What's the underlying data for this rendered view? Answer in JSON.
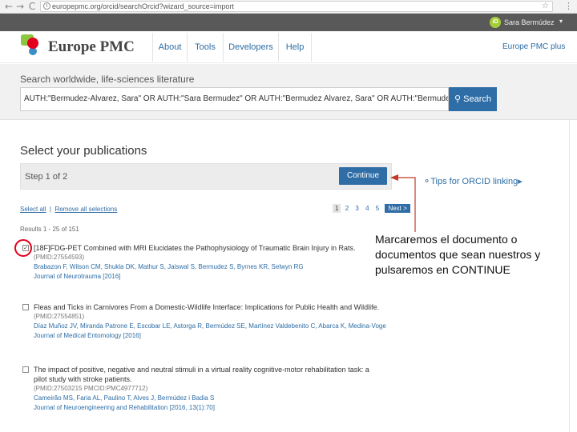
{
  "browser": {
    "back": "←",
    "forward": "→",
    "reload": "C",
    "url": "europepmc.org/orcid/searchOrcid?wizard_source=import",
    "star": "☆",
    "menu": "⋮"
  },
  "user": {
    "orcid_badge": "iD",
    "name": "Sara Bermúdez",
    "caret": "▾"
  },
  "header": {
    "logo_text": "Europe PMC",
    "nav": [
      "About",
      "Tools",
      "Developers",
      "Help"
    ],
    "pmc_plus": "Europe PMC plus"
  },
  "search": {
    "label": "Search worldwide, life-sciences literature",
    "query": "AUTH:\"Bermudez-Alvarez, Sara\" OR AUTH:\"Sara Bermudez\" OR AUTH:\"Bermudez Alvarez, Sara\" OR AUTH:\"Bermudez-Alvarez, S\" OR",
    "button": "Search"
  },
  "publications": {
    "title": "Select your publications",
    "step": "Step 1 of 2",
    "continue": "Continue",
    "tips": "Tips for ORCID linking",
    "select_all": "Select all",
    "remove_all": "Remove all selections",
    "pages": [
      "1",
      "2",
      "3",
      "4",
      "5"
    ],
    "next": "Next",
    "results_count": "Results 1 - 25 of 151"
  },
  "results": [
    {
      "checked": true,
      "title": "[18F]FDG-PET Combined with MRI Elucidates the Pathophysiology of Traumatic Brain Injury in Rats.",
      "meta": "(PMID:27554593)",
      "authors": "Brabazon F, Wilson CM, Shukla DK, Mathur S, Jaiswal S, Bermudez S, Byrnes KR, Selwyn RG",
      "journal": "Journal of Neurotrauma [2016]"
    },
    {
      "checked": false,
      "title": "Fleas and Ticks in Carnivores From a Domestic-Wildlife Interface: Implications for Public Health and Wildlife.",
      "meta": "(PMID:27554851)",
      "authors": "Díaz Muñoz JV, Miranda Patrone E, Escobar LE, Astorga R, Bermúdez SE, Martínez Valdebenito C, Abarca K, Medina-Vogel G",
      "journal": "Journal of Medical Entomology [2016]"
    },
    {
      "checked": false,
      "title": "The impact of positive, negative and neutral stimuli in a virtual reality cognitive-motor rehabilitation task: a pilot study with stroke patients.",
      "meta": "(PMID:27503215 PMCID:PMC4977712)",
      "authors": "Cameirão MS, Faria AL, Paulino T, Alves J, Bermúdez i Badia S",
      "journal": "Journal of Neuroengineering and Rehabilitation [2016, 13(1):70]"
    }
  ],
  "annotation": {
    "text": "Marcaremos el documento o documentos que sean nuestros y pulsaremos en CONTINUE"
  },
  "colors": {
    "brand_blue": "#2f6da6",
    "link_blue": "#2e6da4",
    "annotation_red": "#e2001a",
    "logo_green": "#8dc63f"
  }
}
